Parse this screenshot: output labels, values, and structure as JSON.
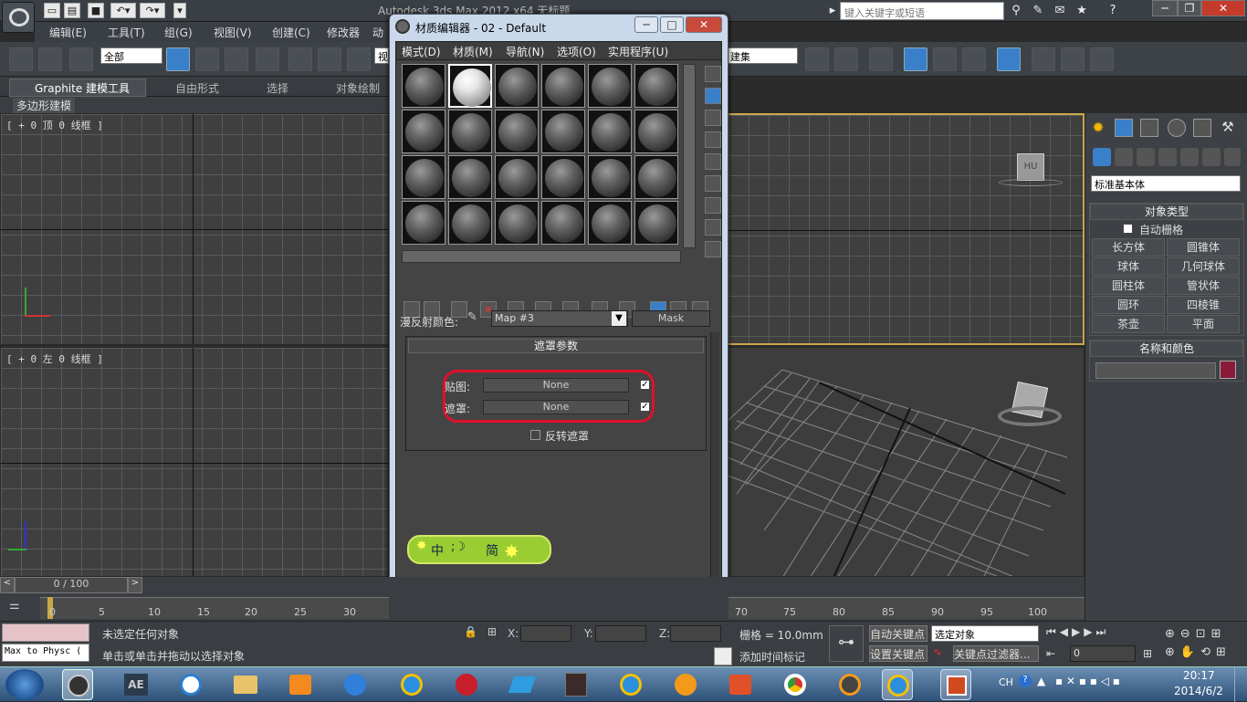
{
  "app": {
    "title": "Autodesk 3ds Max  2012 x64      无标题",
    "search_placeholder": "键入关键字或短语"
  },
  "menu": [
    "编辑(E)",
    "工具(T)",
    "组(G)",
    "视图(V)",
    "创建(C)",
    "修改器",
    "动"
  ],
  "toolbar": {
    "selection_filter": "全部",
    "view_label": "视",
    "named_selection": "建集"
  },
  "ribbon": {
    "tabs": [
      "Graphite 建模工具",
      "自由形式",
      "选择",
      "对象绘制"
    ],
    "sub": "多边形建模"
  },
  "viewports": {
    "top": "[ + 0 顶 0 线框 ]",
    "left": "[ + 0 左 0 线框 ]"
  },
  "command_panel": {
    "dropdown": "标准基本体",
    "object_type_header": "对象类型",
    "autogrid": "自动栅格",
    "buttons": [
      "长方体",
      "圆锥体",
      "球体",
      "几何球体",
      "圆柱体",
      "管状体",
      "圆环",
      "四棱锥",
      "茶壶",
      "平面"
    ],
    "name_color_header": "名称和颜色",
    "object_color": "#8b1a3a"
  },
  "material_editor": {
    "title": "材质编辑器 - 02 - Default",
    "menu": [
      "模式(D)",
      "材质(M)",
      "导航(N)",
      "选项(O)",
      "实用程序(U)"
    ],
    "diffuse_label": "漫反射颜色:",
    "map_name": "Map #3",
    "map_type": "Mask",
    "rollout_title": "遮罩参数",
    "map_label": "贴图:",
    "mask_label": "遮罩:",
    "map_value": "None",
    "mask_value": "None",
    "invert_label": "反转遮罩",
    "ime_text": "中",
    "ime_mode": "简"
  },
  "timeline": {
    "frame": "0 / 100",
    "ticks": [
      "0",
      "5",
      "10",
      "15",
      "20",
      "25",
      "30",
      "70",
      "75",
      "80",
      "85",
      "90",
      "95",
      "100"
    ]
  },
  "status": {
    "script_box": "Max to Physc (",
    "msg1": "未选定任何对象",
    "msg2": "单击或单击并拖动以选择对象",
    "x_label": "X:",
    "y_label": "Y:",
    "z_label": "Z:",
    "grid": "栅格 = 10.0mm",
    "add_time_tag": "添加时间标记",
    "auto_key": "自动关键点",
    "set_key": "设置关键点",
    "selected_objects": "选定对象",
    "key_filters": "关键点过滤器...",
    "frame_value": "0"
  },
  "taskbar": {
    "ae_label": "AE",
    "lang": "CH",
    "time": "20:17",
    "date": "2014/6/2"
  }
}
